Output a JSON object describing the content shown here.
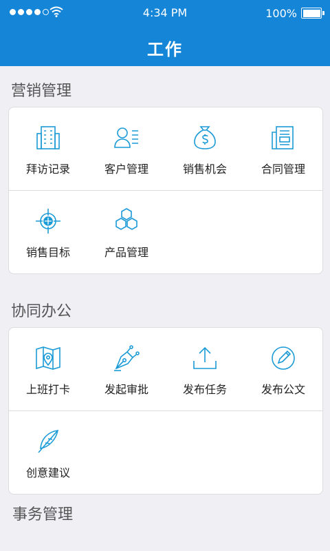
{
  "status_bar": {
    "time": "4:34 PM",
    "battery": "100%"
  },
  "header": {
    "title": "工作"
  },
  "sections": [
    {
      "title": "营销管理",
      "items": [
        {
          "label": "拜访记录",
          "icon": "building-icon"
        },
        {
          "label": "客户管理",
          "icon": "customer-list-icon"
        },
        {
          "label": "销售机会",
          "icon": "money-bag-icon"
        },
        {
          "label": "合同管理",
          "icon": "contract-icon"
        },
        {
          "label": "销售目标",
          "icon": "target-icon"
        },
        {
          "label": "产品管理",
          "icon": "hexagons-icon"
        }
      ]
    },
    {
      "title": "协同办公",
      "items": [
        {
          "label": "上班打卡",
          "icon": "map-pin-icon"
        },
        {
          "label": "发起审批",
          "icon": "pen-nib-icon"
        },
        {
          "label": "发布任务",
          "icon": "upload-icon"
        },
        {
          "label": "发布公文",
          "icon": "edit-circle-icon"
        },
        {
          "label": "创意建议",
          "icon": "feather-icon"
        }
      ]
    },
    {
      "title": "事务管理",
      "items": []
    }
  ],
  "colors": {
    "primary": "#1585d8",
    "icon": "#1a9ad6",
    "background": "#efeff4"
  }
}
